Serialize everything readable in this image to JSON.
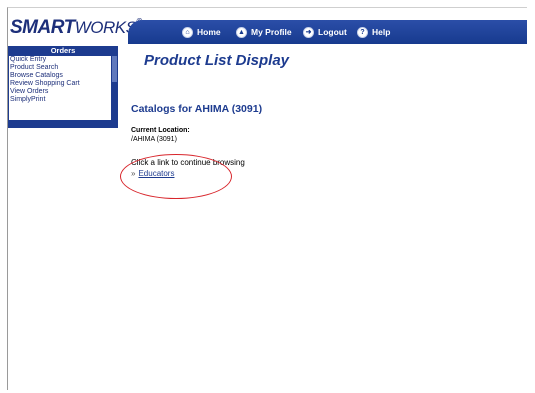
{
  "header": {
    "logo_main": "SMART",
    "logo_suffix": "WORKS",
    "logo_mark": "®",
    "nav": [
      {
        "label": "Home",
        "icon": "home-icon"
      },
      {
        "label": "My Profile",
        "icon": "profile-icon"
      },
      {
        "label": "Logout",
        "icon": "logout-icon"
      },
      {
        "label": "Help",
        "icon": "help-icon"
      }
    ]
  },
  "sidebar": {
    "title": "Orders",
    "items": [
      {
        "label": "Quick Entry"
      },
      {
        "label": "Product Search"
      },
      {
        "label": "Browse Catalogs"
      },
      {
        "label": "Review Shopping Cart"
      },
      {
        "label": "View Orders"
      },
      {
        "label": "SimplyPrint"
      }
    ]
  },
  "main": {
    "page_title": "Product List Display",
    "catalog_title": "Catalogs for AHIMA (3091)",
    "location_label": "Current Location:",
    "location_value": "/AHIMA (3091)",
    "hint": "Click a link to continue browsing",
    "link_bullet": "»",
    "link_label": "Educators"
  },
  "colors": {
    "brand": "#1d3b8f",
    "highlight": "#d8262c"
  }
}
